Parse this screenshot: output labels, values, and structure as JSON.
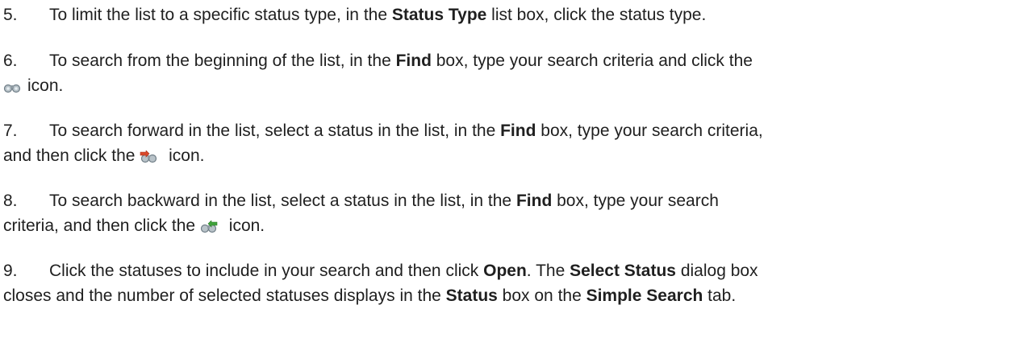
{
  "steps": [
    {
      "number": "5.",
      "parts": [
        "To limit the list to a specific status type, in the ",
        "Status Type",
        " list box, click the status type."
      ]
    },
    {
      "number": "6.",
      "parts": [
        "To search from the beginning of the list, in the ",
        "Find",
        " box, type your search criteria and click the",
        "icon."
      ],
      "icon": "find-first-binoculars-icon"
    },
    {
      "number": "7.",
      "parts": [
        "To search forward in the list, select a status in the list, in the ",
        "Find",
        " box, type your search criteria,",
        "and then click the ",
        " icon."
      ],
      "icon": "find-next-binoculars-icon"
    },
    {
      "number": "8.",
      "parts": [
        "To search backward in the list, select a status in the list, in the ",
        "Find",
        " box, type your search",
        "criteria, and then click the ",
        " icon."
      ],
      "icon": "find-previous-binoculars-icon"
    },
    {
      "number": "9.",
      "parts": [
        "Click the statuses to include in your search and then click ",
        "Open",
        ". The ",
        "Select Status",
        " dialog box",
        "closes and the number of selected statuses displays in the ",
        "Status",
        " box on the ",
        "Simple Search",
        " tab."
      ]
    }
  ]
}
